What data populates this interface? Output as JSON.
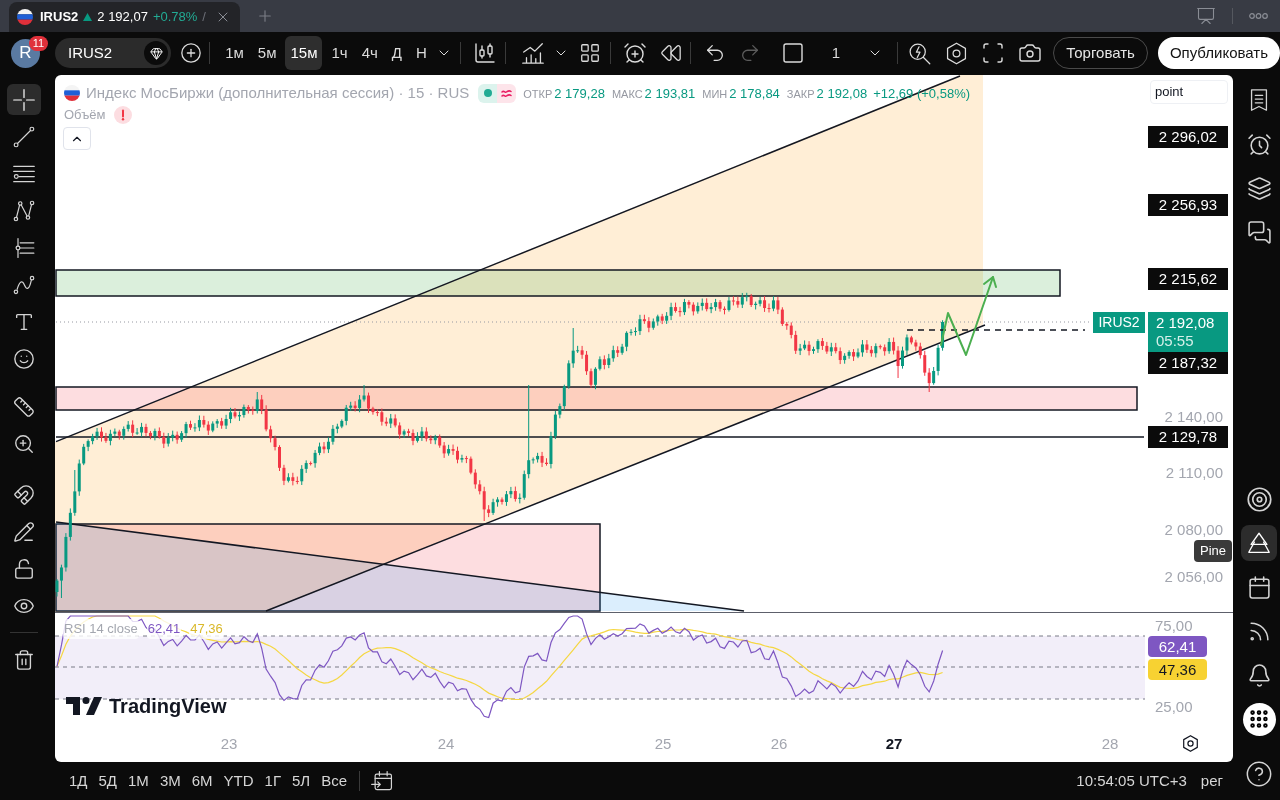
{
  "browser_tab": {
    "symbol": "IRUS2",
    "price": "2 192,07",
    "change": "+0.78%",
    "cut_text": "/"
  },
  "toolbar": {
    "avatar": "R",
    "notifications": "11",
    "symbol": "IRUS2",
    "intervals": [
      {
        "label": "1м",
        "selected": false
      },
      {
        "label": "5м",
        "selected": false
      },
      {
        "label": "15м",
        "selected": true
      },
      {
        "label": "1ч",
        "selected": false
      },
      {
        "label": "4ч",
        "selected": false
      },
      {
        "label": "Д",
        "selected": false
      },
      {
        "label": "Н",
        "selected": false
      }
    ],
    "layout_count": "1",
    "trade_button": "Торговать",
    "publish_button": "Опубликовать"
  },
  "left_tools": [
    {
      "kind": "crosshair",
      "selected": true
    },
    {
      "kind": "trend_line",
      "selected": false
    },
    {
      "kind": "fib",
      "selected": false
    },
    {
      "kind": "pattern",
      "selected": false
    },
    {
      "kind": "projection",
      "selected": false
    },
    {
      "kind": "brush",
      "selected": false
    },
    {
      "kind": "text",
      "selected": false
    },
    {
      "kind": "emoji",
      "selected": false
    },
    {
      "kind": "ruler",
      "selected": false
    },
    {
      "kind": "zoom",
      "selected": false
    },
    {
      "kind": "magnet",
      "selected": false
    },
    {
      "kind": "drawing_mode",
      "selected": false
    },
    {
      "kind": "lock",
      "selected": false
    },
    {
      "kind": "visibility",
      "selected": false
    },
    {
      "kind": "trash",
      "selected": false
    }
  ],
  "chart": {
    "legend": {
      "title": "Индекс МосБиржи (дополнительная сессия) · 15 · RUS",
      "values": [
        {
          "label": "ОТКР",
          "value": "2 179,28"
        },
        {
          "label": "МАКС",
          "value": "2 193,81"
        },
        {
          "label": "МИН",
          "value": "2 178,84"
        },
        {
          "label": "ЗАКР",
          "value": "2 192,08"
        }
      ],
      "change": "+12,69 (+0,58%)"
    },
    "volume": {
      "label": "Объём",
      "warning": true
    },
    "scale_unit": "point",
    "price_labels": [
      {
        "kind": "marker",
        "text": "2 296,02"
      },
      {
        "kind": "marker",
        "text": "2 256,93"
      },
      {
        "kind": "marker",
        "text": "2 215,62"
      },
      {
        "kind": "last",
        "symbol": "IRUS2",
        "text": "2 192,08",
        "countdown": "05:55"
      },
      {
        "kind": "marker",
        "text": "2 187,32"
      },
      {
        "kind": "tick",
        "text": "2 140,00"
      },
      {
        "kind": "marker",
        "text": "2 129,78"
      },
      {
        "kind": "tick",
        "text": "2 110,00"
      },
      {
        "kind": "tick",
        "text": "2 080,00"
      },
      {
        "kind": "tick",
        "text": "2 056,00"
      }
    ],
    "rsi": {
      "legend": "RSI 14 close",
      "value": "62,41",
      "average": "47,36",
      "scale": [
        {
          "kind": "tick",
          "text": "75,00"
        },
        {
          "kind": "value",
          "text": "62,41"
        },
        {
          "kind": "average",
          "text": "47,36"
        },
        {
          "kind": "tick",
          "text": "25,00"
        }
      ]
    },
    "logo": "TradingView",
    "time_labels": [
      {
        "text": "23",
        "current": false
      },
      {
        "text": "24",
        "current": false
      },
      {
        "text": "25",
        "current": false
      },
      {
        "text": "26",
        "current": false
      },
      {
        "text": "27",
        "current": true
      },
      {
        "text": "28",
        "current": false
      }
    ]
  },
  "right_panel": [
    {
      "kind": "watchlist",
      "selected": false
    },
    {
      "kind": "alerts",
      "selected": false
    },
    {
      "kind": "layers",
      "selected": false
    },
    {
      "kind": "chat",
      "selected": false
    },
    {
      "kind": "target",
      "selected": false
    },
    {
      "kind": "pine",
      "selected": true,
      "tooltip": "Pine"
    },
    {
      "kind": "calendar",
      "selected": false
    },
    {
      "kind": "stream",
      "selected": false
    },
    {
      "kind": "bell",
      "selected": false
    },
    {
      "kind": "apps",
      "selected": false
    },
    {
      "kind": "help",
      "selected": false
    }
  ],
  "date_ranges": [
    "1Д",
    "5Д",
    "1М",
    "3М",
    "6М",
    "YTD",
    "1Г",
    "5Л",
    "Все"
  ],
  "status_bar": {
    "time": "10:54:05 UTC+3",
    "adjustment": "рег"
  }
}
